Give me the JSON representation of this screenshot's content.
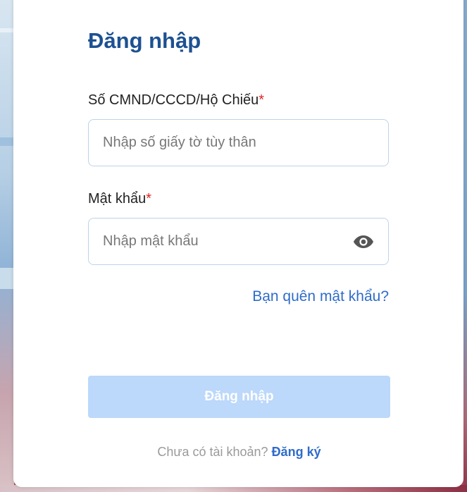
{
  "login": {
    "title": "Đăng nhập",
    "id_label": "Số CMND/CCCD/Hộ Chiếu",
    "required_mark": "*",
    "id_placeholder": "Nhập số giấy tờ tùy thân",
    "id_value": "",
    "password_label": "Mật khẩu",
    "password_placeholder": "Nhập mật khẩu",
    "password_value": "",
    "show_password_icon": "eye-icon",
    "forgot_link": "Bạn quên mật khẩu?",
    "submit_label": "Đăng nhập",
    "no_account_text": "Chưa có tài khoản?",
    "signup_link": "Đăng ký"
  },
  "colors": {
    "title": "#1d5192",
    "link": "#2f6cc8",
    "required": "#e02424",
    "button_disabled_bg": "#bcd8fa",
    "field_border": "#bed3ea"
  }
}
